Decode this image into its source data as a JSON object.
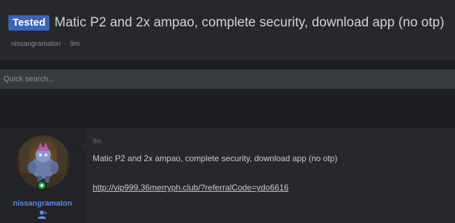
{
  "thread": {
    "tag": "Tested",
    "title": "Matic P2 and 2x ampao, complete security, download app (no otp)",
    "author": "nissangramaton",
    "separator": "·",
    "age": "9m"
  },
  "search": {
    "placeholder": "Quick search..."
  },
  "post": {
    "time": "9m",
    "username": "nissangramaton",
    "text": "Matic P2 and 2x ampao, complete security, download app (no otp)",
    "link": "http://vip999.36merryph.club/?referralCode=ydo6616"
  },
  "colors": {
    "tag_bg": "#3b63b8",
    "username": "#5a8fe0",
    "online": "#2a9d4b",
    "background": "#1f2024",
    "panel": "#27282d"
  },
  "icons": [
    "online-status-icon",
    "user-role-icon"
  ]
}
